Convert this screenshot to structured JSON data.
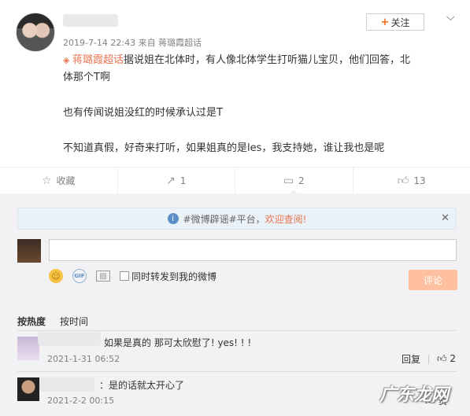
{
  "post": {
    "meta": "2019-7-14 22:43 来自 蒋璐霞超话",
    "follow_label": "关注",
    "topic": "蒋璐霞超话",
    "line1": "据说姐在北体时，有人像北体学生打听猫儿宝贝，他们回答，北",
    "line2": "体那个T啊",
    "para2": "也有传闻说姐没红的时候承认过是T",
    "para3": "不知道真假，好奇来打听，如果姐真的是les，我支持她，谁让我也是呢"
  },
  "actions": {
    "favorite_label": "收藏",
    "repost_count": "1",
    "comment_count": "2",
    "like_count": "13"
  },
  "notice": {
    "prefix": "#微博辟谣#平台，",
    "link": "欢迎查阅!"
  },
  "composer": {
    "input_value": "",
    "repost_label": "同时转发到我的微博",
    "submit_label": "评论"
  },
  "sort": {
    "hot": "按热度",
    "time": "按时间"
  },
  "comments": [
    {
      "text": "如果是真的 那可太欣慰了! yes! ! !",
      "time": "2021-1-31 06:52",
      "reply": "回复",
      "likes": "2"
    },
    {
      "text": "：是的话就太开心了",
      "time": "2021-2-2 00:15",
      "likes_label": "赞"
    }
  ],
  "watermark": "广东龙网"
}
